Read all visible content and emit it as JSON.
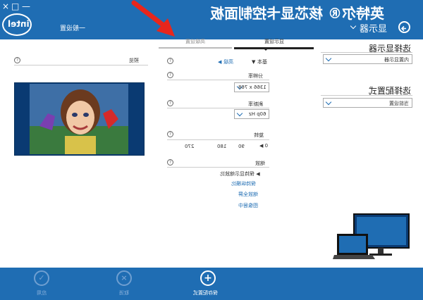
{
  "header": {
    "title": "英特尔® 核芯显卡控制面板",
    "logo": "intel",
    "window_controls": [
      "×",
      "□",
      "—"
    ],
    "nav_general": "一般设置",
    "nav_display": "显示器"
  },
  "tabs": [
    {
      "label": "高级设置",
      "active": false
    },
    {
      "label": "显示设置",
      "active": true
    }
  ],
  "right_panel": {
    "select_display_heading": "选择显示器",
    "select_display_value": "内置显示器",
    "select_profile_heading": "选择配置式",
    "select_profile_value": "当前设置"
  },
  "settings": {
    "basic_label": "基本",
    "advanced_label": "高级",
    "resolution_label": "分辨率",
    "resolution_value": "1366 x 768",
    "refresh_label": "刷新率",
    "refresh_value": "60p Hz",
    "rotation_label": "旋转",
    "rotation_options": [
      "0",
      "90",
      "180",
      "270"
    ],
    "scaling_label": "缩放",
    "scaling_option": "保持显示缩放比",
    "scaling_links": [
      "保持纵横比",
      "缩放全屏",
      "图像居中"
    ],
    "preview_label": "预览"
  },
  "footer": {
    "save_label": "保存配置式",
    "cancel_label": "取消",
    "apply_label": "应用"
  },
  "colors": {
    "brand_blue": "#1f6db3",
    "annotation_arrow": "#e8261c"
  }
}
